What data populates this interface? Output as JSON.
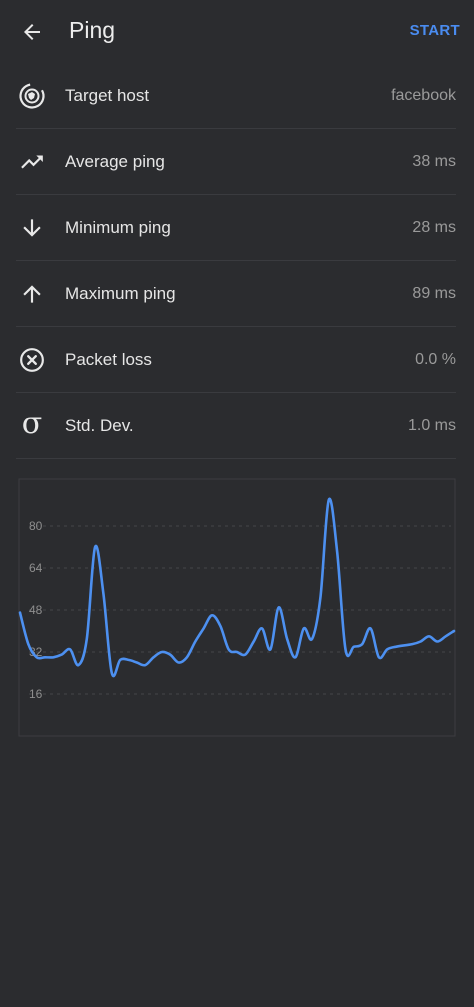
{
  "header": {
    "title": "Ping",
    "start_label": "START"
  },
  "stats": [
    {
      "icon": "target-host-icon",
      "label": "Target host",
      "value": "facebook"
    },
    {
      "icon": "trending-up-icon",
      "label": "Average ping",
      "value": "38 ms"
    },
    {
      "icon": "arrow-down-icon",
      "label": "Minimum ping",
      "value": "28 ms"
    },
    {
      "icon": "arrow-up-icon",
      "label": "Maximum ping",
      "value": "89 ms"
    },
    {
      "icon": "packet-loss-icon",
      "label": "Packet loss",
      "value": "0.0 %"
    },
    {
      "icon": "sigma-icon",
      "label": "Std. Dev.",
      "value": "1.0 ms"
    }
  ],
  "colors": {
    "accent": "#4a8cf0",
    "background": "#2b2c2f",
    "line": "#4d90f0"
  },
  "chart_data": {
    "type": "line",
    "title": "",
    "xlabel": "",
    "ylabel": "",
    "ylim": [
      0,
      96
    ],
    "yticks": [
      16,
      32,
      48,
      64,
      80
    ],
    "grid": true,
    "x": [
      0,
      1,
      2,
      3,
      4,
      5,
      6,
      7,
      8,
      9,
      10,
      11,
      12,
      13,
      14,
      15,
      16,
      17,
      18,
      19,
      20,
      21,
      22,
      23,
      24,
      25,
      26,
      27,
      28,
      29,
      30,
      31,
      32,
      33,
      34,
      35,
      36,
      37,
      38,
      39,
      40,
      41,
      42,
      43,
      44,
      45,
      47,
      48,
      49,
      50,
      51,
      52
    ],
    "series": [
      {
        "values": [
          47,
          35,
          30,
          30,
          30,
          31,
          33,
          27,
          37,
          72,
          54,
          24,
          29,
          29,
          28,
          27,
          30,
          32,
          31,
          28,
          30,
          36,
          41,
          46,
          42,
          33,
          32,
          31,
          36,
          41,
          33,
          49,
          37,
          30,
          41,
          37,
          53,
          90,
          70,
          33,
          34,
          35,
          41,
          30,
          33,
          34,
          35,
          36,
          38,
          36,
          38,
          40
        ]
      }
    ]
  }
}
